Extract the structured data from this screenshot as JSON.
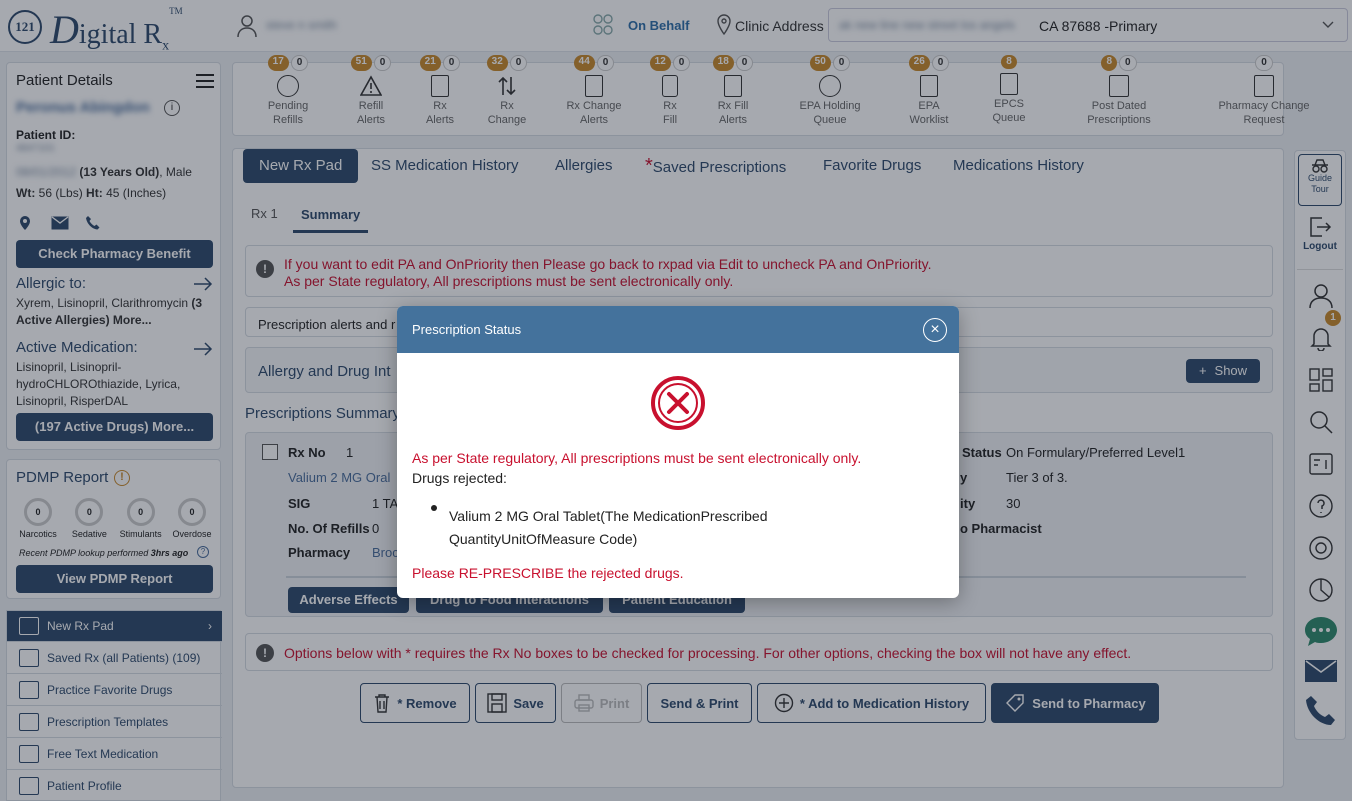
{
  "header": {
    "logo_mark": "121",
    "logo_d": "D",
    "logo_rest": "igital R",
    "logo_x": "x",
    "logo_tm": "TM",
    "user_name": "steve n smith",
    "on_behalf": "On Behalf",
    "clinic_label": "Clinic Address",
    "clinic_value_blur": "ak new line new street los angels",
    "clinic_value": "CA 87688 -Primary"
  },
  "patient": {
    "title": "Patient Details",
    "name": "Peronus Abingdon",
    "id_label": "Patient ID:",
    "id_value": "4847101",
    "dob": "08/01/2012",
    "age": "(13 Years Old)",
    "gender": ", Male",
    "wt_label": "Wt:",
    "wt_value": "56 (Lbs)",
    "ht_label": "Ht:",
    "ht_value": "45 (Inches)",
    "check_benefit": "Check Pharmacy Benefit",
    "allergic_title": "Allergic to:",
    "allergies": "Xyrem, Lisinopril, Clarithromycin",
    "allergies_more": "(3 Active Allergies) More...",
    "active_med_title": "Active Medication:",
    "active_meds": "Lisinopril, Lisinopril-hydroCHLOROthiazide, Lyrica, Lisinopril, RisperDAL",
    "active_drugs_btn": "(197 Active Drugs) More..."
  },
  "pdmp": {
    "title": "PDMP Report",
    "items": [
      {
        "label": "Narcotics",
        "value": "0"
      },
      {
        "label": "Sedative",
        "value": "0"
      },
      {
        "label": "Stimulants",
        "value": "0"
      },
      {
        "label": "Overdose",
        "value": "0"
      }
    ],
    "recent_prefix": "Recent PDMP lookup performed",
    "recent_time": "3hrs ago",
    "view_btn": "View PDMP Report"
  },
  "nav": [
    {
      "label": "New Rx Pad"
    },
    {
      "label": "Saved Rx (all Patients) (109)"
    },
    {
      "label": "Practice Favorite Drugs"
    },
    {
      "label": "Prescription Templates"
    },
    {
      "label": "Free Text Medication"
    },
    {
      "label": "Patient Profile"
    }
  ],
  "alerts": [
    {
      "b1": "17",
      "b2": "0",
      "l1": "Pending",
      "l2": "Refills"
    },
    {
      "b1": "51",
      "b2": "0",
      "l1": "Refill",
      "l2": "Alerts"
    },
    {
      "b1": "21",
      "b2": "0",
      "l1": "Rx",
      "l2": "Alerts"
    },
    {
      "b1": "32",
      "b2": "0",
      "l1": "Rx",
      "l2": "Change"
    },
    {
      "b1": "44",
      "b2": "0",
      "l1": "Rx Change",
      "l2": "Alerts"
    },
    {
      "b1": "12",
      "b2": "0",
      "l1": "Rx",
      "l2": "Fill"
    },
    {
      "b1": "18",
      "b2": "0",
      "l1": "Rx Fill",
      "l2": "Alerts"
    },
    {
      "b1": "50",
      "b2": "0",
      "l1": "EPA Holding",
      "l2": "Queue"
    },
    {
      "b1": "26",
      "b2": "0",
      "l1": "EPA",
      "l2": "Worklist"
    },
    {
      "b1": "8",
      "b2": "",
      "l1": "EPCS",
      "l2": "Queue"
    },
    {
      "b1": "8",
      "b2": "0",
      "l1": "Post Dated",
      "l2": "Prescriptions"
    },
    {
      "b1": "",
      "b2": "0",
      "l1": "Pharmacy Change",
      "l2": "Request"
    }
  ],
  "tabs": [
    "New Rx Pad",
    "SS Medication History",
    "Allergies",
    "Saved Prescriptions",
    "Favorite Drugs",
    "Medications History"
  ],
  "tab_star": "*",
  "subtabs": [
    "Rx 1",
    "Summary"
  ],
  "info1": {
    "line1": "If you want to edit PA and OnPriority then Please go back to rxpad via Edit to uncheck PA and OnPriority.",
    "line2": "As per State regulatory, All prescriptions must be sent electronically only."
  },
  "rx_alerts_text": "Prescription alerts and r",
  "allergy_section": "Allergy and Drug Int",
  "show_btn": "Show",
  "presc_summary": "Prescriptions Summary",
  "rx": {
    "rxno_label": "Rx No",
    "rxno": "1",
    "drug": "Valium 2 MG Oral",
    "sig_label": "SIG",
    "sig": "1 TA",
    "refills_label": "No. Of Refills",
    "refills": "0",
    "pharmacy_label": "Pharmacy",
    "pharmacy": "Broc",
    "status_label": "Status",
    "status": "On Formulary/Preferred Level1",
    "tier_label": "y",
    "tier": "Tier 3 of 3.",
    "qty_label": "ity",
    "qty": "30",
    "to_pharm": "o Pharmacist",
    "btn_adverse": "Adverse Effects",
    "btn_food": "Drug to Food Interactions",
    "btn_edu": "Patient Education"
  },
  "info2": "Options below with * requires the Rx No boxes to be checked for processing. For other options, checking the box will not have any effect.",
  "actions": {
    "remove": "* Remove",
    "save": "Save",
    "print": "Print",
    "send_print": "Send & Print",
    "add_history": "* Add to Medication History",
    "send_pharmacy": "Send to Pharmacy"
  },
  "right": {
    "guide1": "Guide",
    "guide2": "Tour",
    "logout": "Logout",
    "notif_count": "1"
  },
  "modal": {
    "title": "Prescription Status",
    "error_msg": "As per State regulatory, All prescriptions must be sent electronically only.",
    "rejected_label": "Drugs rejected:",
    "rejected_item1": "Valium 2 MG Oral Tablet(The MedicationPrescribed",
    "rejected_item2": "QuantityUnitOfMeasure Code)",
    "represcribe": "Please RE-PRESCRIBE the rejected drugs."
  },
  "colors": {
    "brand": "#2e4a6b",
    "modal_header": "#44729c",
    "error": "#c8102e",
    "badge": "#c98a2b"
  }
}
